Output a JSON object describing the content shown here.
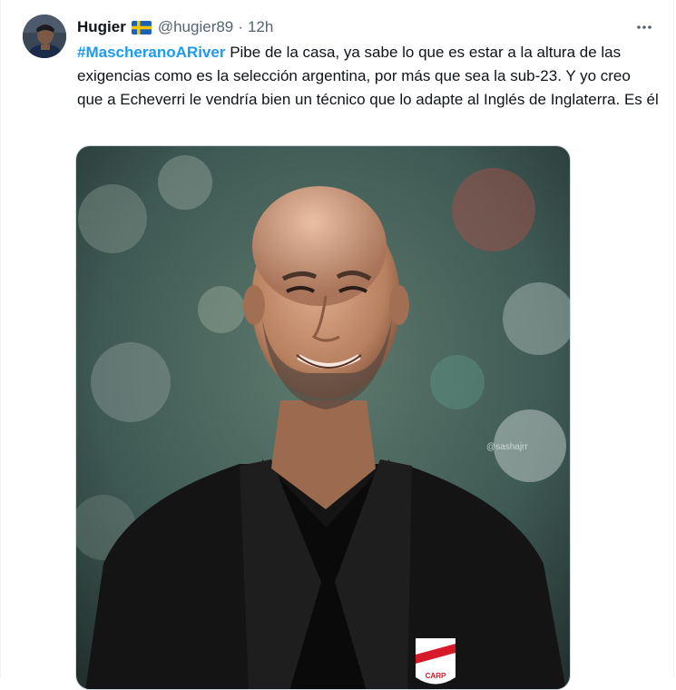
{
  "tweet": {
    "author": {
      "display_name": "Hugier",
      "flag": "swedish-flag-icon",
      "handle": "@hugier89",
      "separator": "·",
      "time": "12h"
    },
    "hashtag": "#MascheranoARiver",
    "body": " Pibe de la casa, ya sabe lo que es estar a la altura de las exigencias como es la selección argentina, por más que sea la sub-23. Y yo creo que a Echeverri le vendría bien un técnico que lo adapte al Inglés de Inglaterra. Es él",
    "media": {
      "watermark": "@sashajrr",
      "badge_text": "CARP"
    }
  },
  "colors": {
    "link": "#1d9bf0",
    "text": "#0f1419",
    "secondary": "#536471"
  }
}
